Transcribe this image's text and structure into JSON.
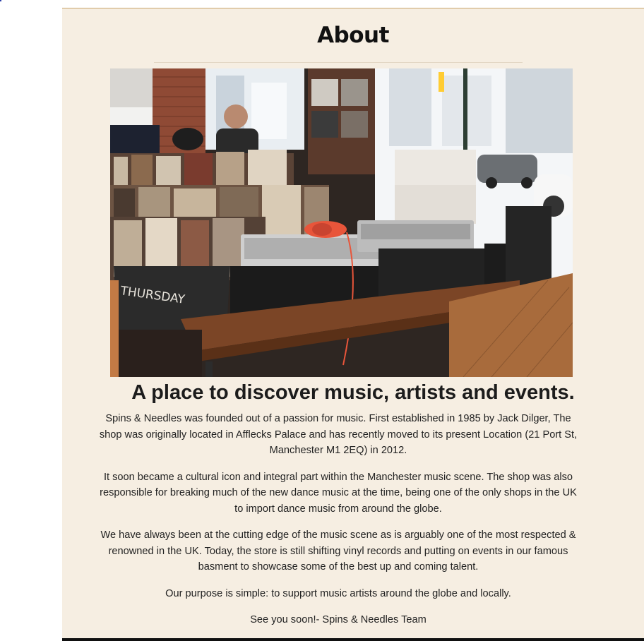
{
  "page": {
    "title": "About",
    "tagline": "A place to discover music, artists and events.",
    "paragraphs": [
      "Spins & Needles was founded out of a passion for music. First established in 1985 by Jack Dilger, The shop was originally located in Afflecks Palace and has recently moved to its present Location (21 Port St, Manchester M1 2EQ) in 2012.",
      "It soon became a cultural icon and integral part within the Manchester music scene. The shop was also responsible for breaking much of the new dance music at the time, being one of the only shops in the UK to import dance music from around the globe.",
      "We have always been at the cutting edge of the music scene as is arguably one of the most respected & renowned in the UK. Today, the store is still shifting vinyl records and putting on events in our famous basment to showcase some of the best up and coming talent.",
      "Our purpose is simple: to support music artists around the globe and locally.",
      "See you soon!- Spins & Needles Team"
    ]
  },
  "hero_image": {
    "crate_label": "THURSDAY"
  },
  "colors": {
    "page_background": "#f6eee2",
    "top_border": "#c9a46b",
    "text": "#222222",
    "headphones_accent": "#e8553a"
  }
}
